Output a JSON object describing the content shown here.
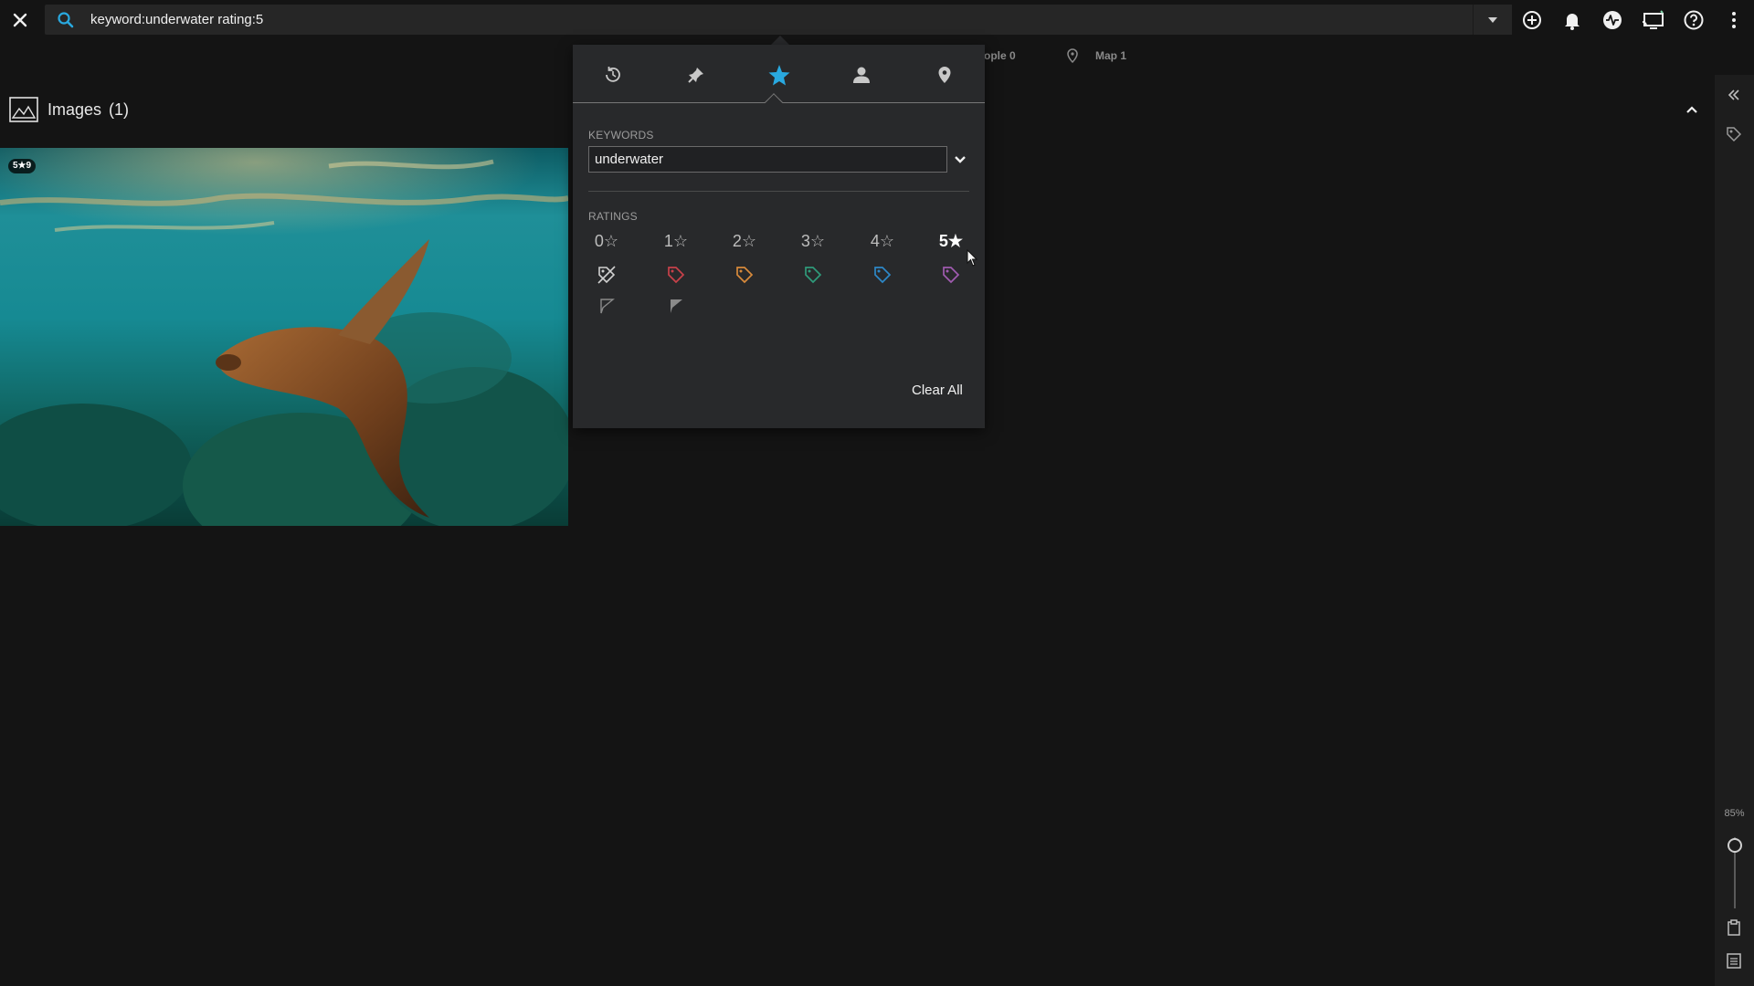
{
  "search": {
    "query": "keyword:underwater rating:5"
  },
  "subnav": {
    "people": "ople 0",
    "map": "Map 1"
  },
  "images": {
    "label": "Images",
    "count": "(1)"
  },
  "photo": {
    "badge": "5★9"
  },
  "zoom": {
    "label": "85%",
    "level_percent": 85
  },
  "popover": {
    "tabs": [
      "history",
      "pin",
      "star",
      "person",
      "location"
    ],
    "active_tab": "star",
    "keywords_label": "KEYWORDS",
    "keyword_value": "underwater",
    "ratings_label": "RATINGS",
    "ratings": [
      "0☆",
      "1☆",
      "2☆",
      "3☆",
      "4☆",
      "5★"
    ],
    "active_rating": "5★",
    "color_tags": [
      "#c8414a",
      "#d88a3b",
      "#2f9a7a",
      "#2d88c8",
      "#a05bb0"
    ],
    "clear_all": "Clear All"
  },
  "colors": {
    "accent": "#29a9e0",
    "background": "#141414",
    "popover": "#28292b"
  }
}
